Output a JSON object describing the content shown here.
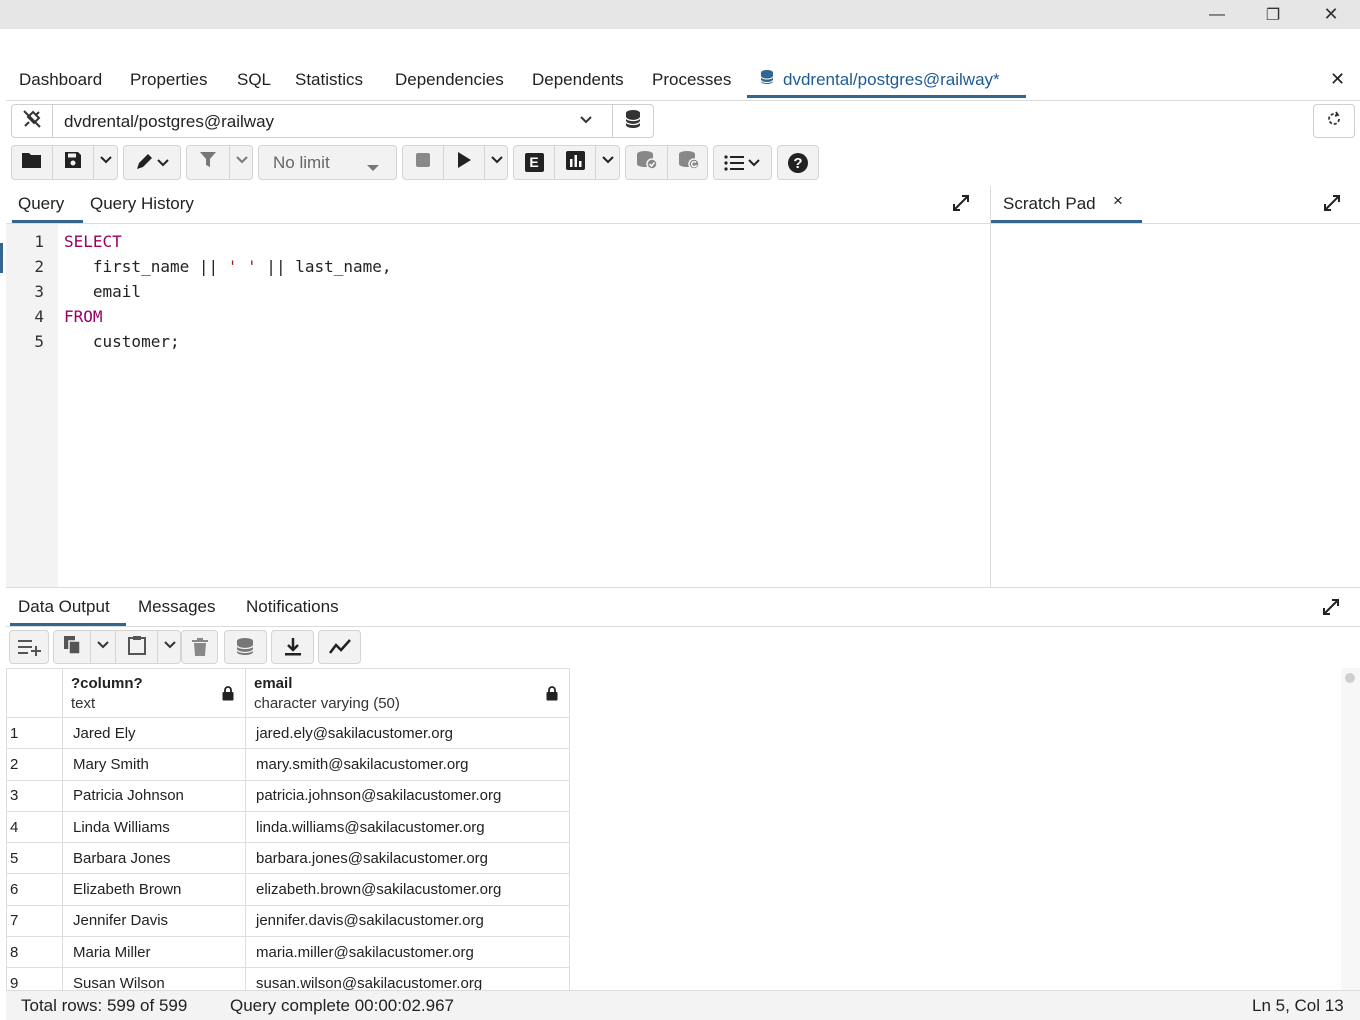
{
  "window": {
    "minimize_label": "—",
    "maximize_label": "❐",
    "close_label": "✕"
  },
  "main_tabs": [
    "Dashboard",
    "Properties",
    "SQL",
    "Statistics",
    "Dependencies",
    "Dependents",
    "Processes"
  ],
  "active_tab": {
    "label": "dvdrental/postgres@railway*",
    "close_label": "✕"
  },
  "connection": {
    "value": "dvdrental/postgres@railway"
  },
  "toolbar": {
    "limit_value": "No limit",
    "explain_label": "E"
  },
  "editor_tabs": {
    "query": "Query",
    "history": "Query History"
  },
  "scratch": {
    "label": "Scratch Pad",
    "close_label": "×"
  },
  "code": {
    "line_numbers": [
      "1",
      "2",
      "3",
      "4",
      "5"
    ],
    "line1": "SELECT",
    "line2_a": "   first_name || ",
    "line2_str": "' '",
    "line2_b": " || last_name,",
    "line3": "   email",
    "line4": "FROM",
    "line5": "   customer;"
  },
  "output_tabs": [
    "Data Output",
    "Messages",
    "Notifications"
  ],
  "grid": {
    "columns": [
      {
        "name": "?column?",
        "type": "text"
      },
      {
        "name": "email",
        "type": "character varying (50)"
      }
    ],
    "rows": [
      [
        "1",
        "Jared Ely",
        "jared.ely@sakilacustomer.org"
      ],
      [
        "2",
        "Mary Smith",
        "mary.smith@sakilacustomer.org"
      ],
      [
        "3",
        "Patricia Johnson",
        "patricia.johnson@sakilacustomer.org"
      ],
      [
        "4",
        "Linda Williams",
        "linda.williams@sakilacustomer.org"
      ],
      [
        "5",
        "Barbara Jones",
        "barbara.jones@sakilacustomer.org"
      ],
      [
        "6",
        "Elizabeth Brown",
        "elizabeth.brown@sakilacustomer.org"
      ],
      [
        "7",
        "Jennifer Davis",
        "jennifer.davis@sakilacustomer.org"
      ],
      [
        "8",
        "Maria Miller",
        "maria.miller@sakilacustomer.org"
      ],
      [
        "9",
        "Susan Wilson",
        "susan.wilson@sakilacustomer.org"
      ]
    ]
  },
  "status": {
    "total_rows": "Total rows: 599 of 599",
    "query_status": "Query complete 00:00:02.967",
    "cursor": "Ln 5, Col 13"
  },
  "colors": {
    "accent": "#326690",
    "keyword": "#990066",
    "string": "#aa1111"
  }
}
